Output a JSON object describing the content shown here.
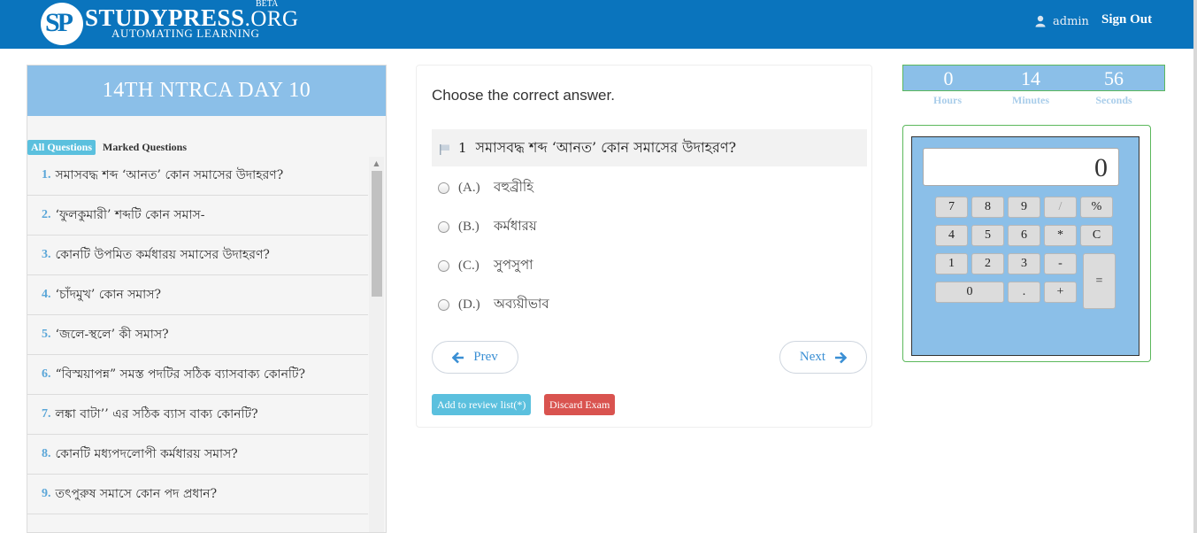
{
  "header": {
    "logo_mark": "SP",
    "logo_name_big": "STUDYPRESS",
    "logo_name_small": ".ORG",
    "logo_beta": "BETA",
    "logo_tagline": "AUTOMATING LEARNING",
    "user_name": "admin",
    "sign_out": "Sign Out"
  },
  "sidebar": {
    "exam_title": "14TH NTRCA DAY 10",
    "tab_all": "All Questions",
    "tab_marked": "Marked Questions",
    "questions": [
      {
        "num": "1.",
        "text": "সমাসবদ্ধ শব্দ ‘আনত’ কোন সমাসের উদাহরণ?"
      },
      {
        "num": "2.",
        "text": "‘ফুলকুমারী’ শব্দটি কোন সমাস-"
      },
      {
        "num": "3.",
        "text": "কোনটি উপমিত কর্মধারয় সমাসের উদাহরণ?"
      },
      {
        "num": "4.",
        "text": "‘চাঁদমুখ’ কোন সমাস?"
      },
      {
        "num": "5.",
        "text": "‘জলে-স্থলে’ কী সমাস?"
      },
      {
        "num": "6.",
        "text": "“বিস্ময়াপন্ন” সমস্ত পদটির সঠিক ব্যাসবাক্য কোনটি?"
      },
      {
        "num": "7.",
        "text": "লঙ্কা বাটা’’ এর সঠিক ব্যাস বাক্য কোনটি?"
      },
      {
        "num": "8.",
        "text": "কোনটি মধ্যপদলোপী কর্মধারয় সমাস?"
      },
      {
        "num": "9.",
        "text": "তৎপুরুষ সমাসে কোন পদ প্রধান?"
      },
      {
        "num": "",
        "text": ""
      }
    ]
  },
  "question": {
    "instruction": "Choose the correct answer.",
    "number": "1",
    "text": "সমাসবদ্ধ শব্দ ‘আনত’ কোন সমাসের উদাহরণ?",
    "options": [
      {
        "letter": "(A.)",
        "text": "বহুব্রীহি"
      },
      {
        "letter": "(B.)",
        "text": "কর্মধারয়"
      },
      {
        "letter": "(C.)",
        "text": "সুপসুপা"
      },
      {
        "letter": "(D.)",
        "text": "অব্যয়ীভাব"
      }
    ],
    "prev_label": "Prev",
    "next_label": "Next",
    "review_label": "Add to review list(*)",
    "discard_label": "Discard Exam"
  },
  "timer": {
    "hours": "0",
    "minutes": "14",
    "seconds": "56",
    "hours_label": "Hours",
    "minutes_label": "Minutes",
    "seconds_label": "Seconds"
  },
  "calculator": {
    "display": "0",
    "keys": {
      "k7": "7",
      "k8": "8",
      "k9": "9",
      "div": "/",
      "pct": "%",
      "k4": "4",
      "k5": "5",
      "k6": "6",
      "mul": "*",
      "clr": "C",
      "k1": "1",
      "k2": "2",
      "k3": "3",
      "sub": "-",
      "eq": "=",
      "k0": "0",
      "dot": ".",
      "add": "+"
    }
  },
  "colors": {
    "header_bg": "#0a74bd",
    "panel_blue": "#8bbfe8",
    "info": "#5bc0de",
    "danger": "#d9534f",
    "success_border": "#5cb85c"
  }
}
